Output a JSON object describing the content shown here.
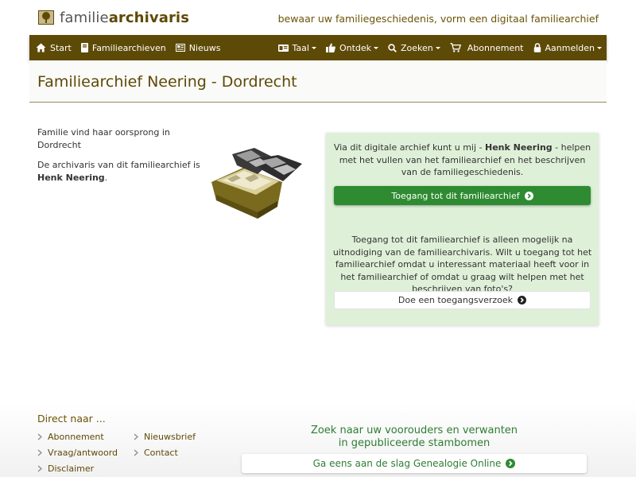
{
  "header": {
    "logo_regular": "familie",
    "logo_bold": "archivaris",
    "tagline": "bewaar uw familiegeschiedenis, vorm een digitaal familiearchief"
  },
  "nav": {
    "start": "Start",
    "familiearchieven": "Familiearchieven",
    "nieuws": "Nieuws",
    "taal": "Taal",
    "ontdek": "Ontdek",
    "zoeken": "Zoeken",
    "abonnement": "Abonnement",
    "aanmelden": "Aanmelden"
  },
  "page": {
    "title": "Familiearchief Neering - Dordrecht"
  },
  "intro": {
    "line1": "Familie vind haar oorsprong in Dordrecht",
    "line2_prefix": "De archivaris van dit familiearchief is",
    "archivist": "Henk Neering",
    "line2_suffix": "."
  },
  "access_box": {
    "text1_prefix": "Via dit digitale archief kunt u mij - ",
    "text1_name": "Henk Neering",
    "text1_suffix": " - helpen met het vullen van het familiearchief en het beschrijven van de familiegeschiedenis.",
    "primary_button": "Toegang tot dit familiearchief",
    "text2": "Toegang tot dit familiearchief is alleen mogelijk na uitnodiging van de familiearchivaris. Wilt u toegang tot het familiearchief omdat u interessant materiaal heeft voor in het familiearchief of omdat u graag wilt helpen met het beschrijven van foto's?",
    "secondary_button": "Doe een toegangsverzoek"
  },
  "footer": {
    "heading": "Direct naar ...",
    "links": [
      "Abonnement",
      "Nieuwsbrief",
      "Vraag/antwoord",
      "Contact",
      "Disclaimer"
    ],
    "promo_line1": "Zoek naar uw voorouders en verwanten",
    "promo_line2": "in gepubliceerde stambomen",
    "promo_button": "Ga eens aan de slag Genealogie Online"
  },
  "colors": {
    "brand_brown": "#5e4a07",
    "accent_green": "#2e8b31",
    "panel_green": "#dff0d8"
  },
  "icons": [
    "tree-logo-icon",
    "home-icon",
    "book-icon",
    "newspaper-icon",
    "id-card-icon",
    "thumbs-up-icon",
    "search-icon",
    "cart-icon",
    "lock-icon",
    "chevron-circle-right-icon",
    "chevron-right-icon"
  ]
}
